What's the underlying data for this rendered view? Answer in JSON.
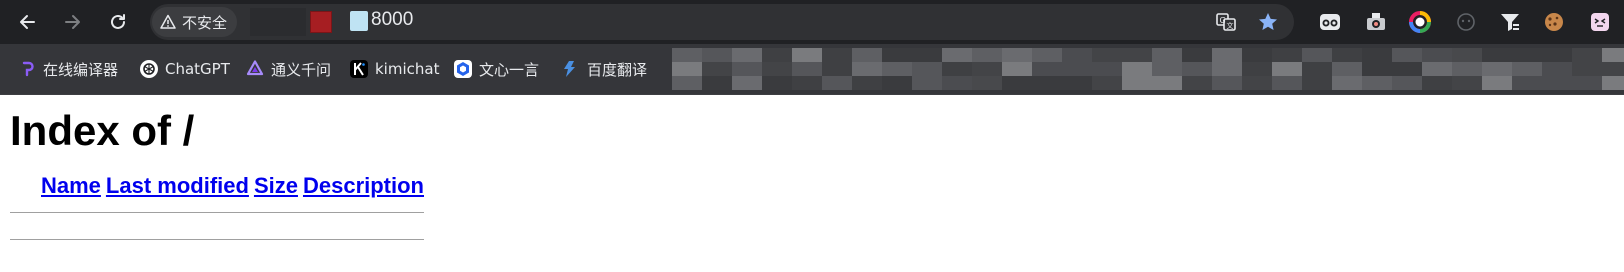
{
  "browser": {
    "security_label": "不安全",
    "url": "8000",
    "colors": {
      "toolbar_bg": "#202124",
      "omnibox_bg": "#303134",
      "bookmarks_bg": "#35363a",
      "star": "#8ab4f8"
    }
  },
  "bookmarks": [
    {
      "label": "在线编译器",
      "icon": "compiler-icon"
    },
    {
      "label": "ChatGPT",
      "icon": "chatgpt-icon"
    },
    {
      "label": "通义千问",
      "icon": "tongyi-icon"
    },
    {
      "label": "kimichat",
      "icon": "kimi-icon"
    },
    {
      "label": "文心一言",
      "icon": "wenxin-icon"
    },
    {
      "label": "百度翻译",
      "icon": "baidu-translate-icon"
    }
  ],
  "page": {
    "title": "Index of /",
    "columns": [
      "Name",
      "Last modified",
      "Size",
      "Description"
    ],
    "link_color": "#0000ee"
  }
}
